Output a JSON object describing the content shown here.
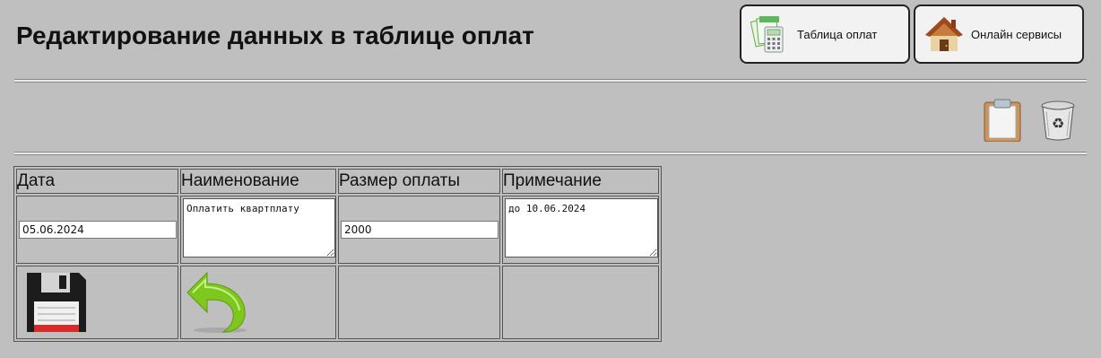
{
  "page": {
    "title": "Редактирование данных в таблице оплат"
  },
  "nav": {
    "table_button": {
      "label": "Таблица оплат",
      "icon": "calculator-spreadsheet-icon"
    },
    "online_button": {
      "label": "Онлайн сервисы",
      "icon": "house-icon"
    }
  },
  "toolbar": {
    "clipboard_icon": "clipboard-icon",
    "trash_icon": "recycle-bin-icon"
  },
  "table": {
    "headers": [
      "Дата",
      "Наименование",
      "Размер оплаты",
      "Примечание"
    ],
    "fields": {
      "date": "05.06.2024",
      "name": "Оплатить квартплату",
      "amount": "2000",
      "note": "до 10.06.2024"
    },
    "actions": {
      "save_icon": "floppy-disk-icon",
      "back_icon": "undo-arrow-icon"
    }
  },
  "colors": {
    "background": "#bfbfbf",
    "button_bg": "#f2f2f2",
    "arrow_green": "#7ec81e",
    "floppy_red": "#d52b2b"
  }
}
